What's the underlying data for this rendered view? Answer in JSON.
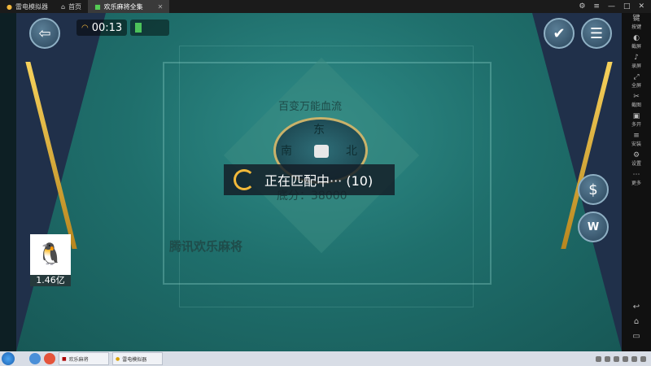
{
  "browser": {
    "tabs": [
      {
        "label": "雷电模拟器"
      },
      {
        "label": "首页"
      },
      {
        "label": "欢乐麻将全集"
      }
    ]
  },
  "game": {
    "timer": "00:13",
    "rule_text": "百变万能血流",
    "score_label": "底分：38000",
    "brand": "腾讯欢乐麻将",
    "compass": {
      "north": "东",
      "west": "南",
      "east": "北"
    },
    "coins": "1.46亿",
    "matching": "正在匹配中··· (10)",
    "w_button": "W"
  },
  "sidebar": {
    "items": [
      {
        "icon": "键",
        "label": "按键"
      },
      {
        "icon": "◐",
        "label": "截屏"
      },
      {
        "icon": "♪",
        "label": "录屏"
      },
      {
        "icon": "⤢",
        "label": "全屏"
      },
      {
        "icon": "✂",
        "label": "截图"
      },
      {
        "icon": "▣",
        "label": "多开"
      },
      {
        "icon": "≡",
        "label": "安装"
      },
      {
        "icon": "⚙",
        "label": "设置"
      },
      {
        "icon": "⋯",
        "label": "更多"
      }
    ]
  },
  "taskbar": {
    "apps": [
      {
        "label": "欢乐麻将"
      },
      {
        "label": "雷电模拟器"
      }
    ]
  }
}
